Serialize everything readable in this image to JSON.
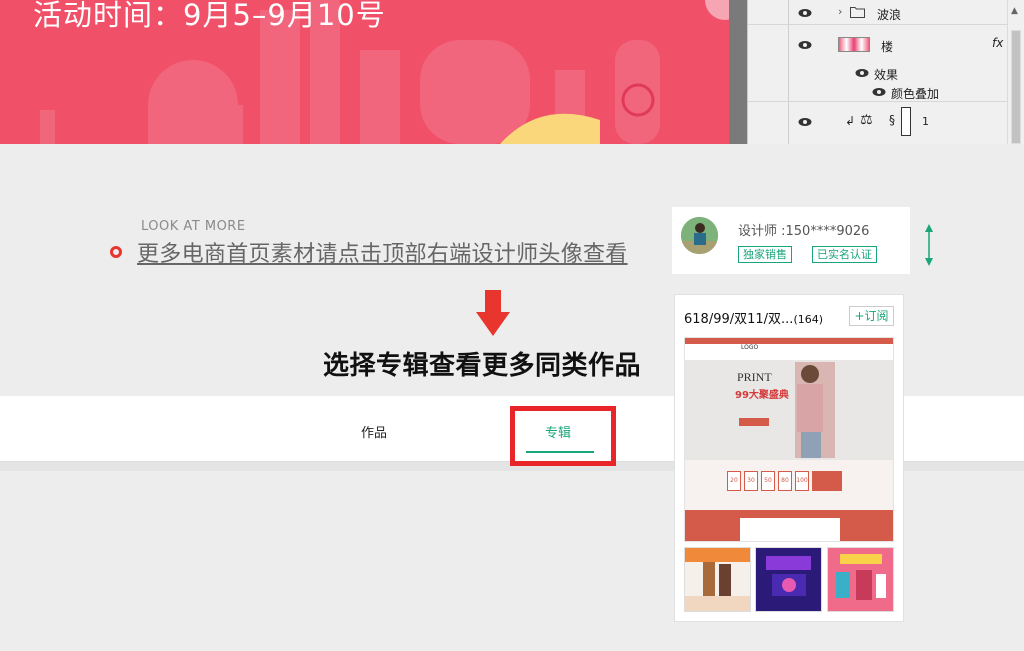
{
  "banner": {
    "title": "活动时间：9月5–9月10号",
    "color": "#f05068"
  },
  "layers_panel": {
    "rows": [
      {
        "name": "波浪",
        "type": "folder"
      },
      {
        "name": "楼",
        "type": "layer",
        "fx": "fx"
      },
      {
        "name": "效果",
        "type": "effect"
      },
      {
        "name": "颜色叠加",
        "type": "effect-item"
      },
      {
        "name": "1",
        "type": "clipped-layer"
      }
    ]
  },
  "look_more": {
    "small": "LOOK AT MORE",
    "big": "更多电商首页素材请点击顶部右端设计师头像查看"
  },
  "headline": "选择专辑查看更多同类作品",
  "tabs": {
    "works": "作品",
    "album": "专辑"
  },
  "designer": {
    "name": "设计师 :150****9026",
    "tag_exclusive": "独家销售",
    "tag_verified": "已实名认证"
  },
  "album": {
    "title": "618/99/双11/双...",
    "count": "(164)",
    "subscribe": "+订阅",
    "preview": {
      "logo": "LOGO",
      "hero_word": "PRINT",
      "hero_sub": "99大聚盛典",
      "coupons": [
        "20",
        "30",
        "50",
        "80",
        "100"
      ]
    }
  },
  "colors": {
    "accent_green": "#1aa57a",
    "highlight_red": "#e8262a"
  }
}
